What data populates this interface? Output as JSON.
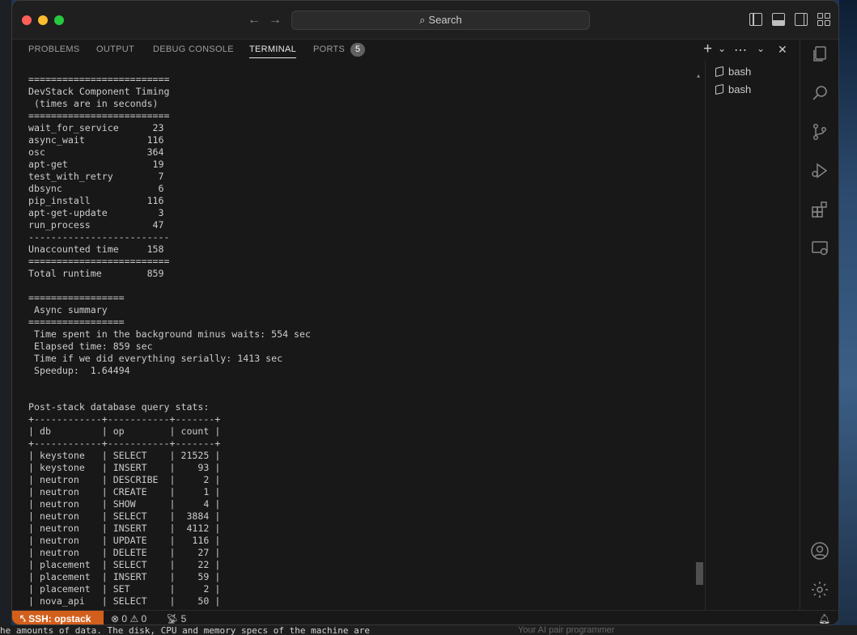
{
  "window": {
    "search_placeholder": "Search",
    "nav_back": "←",
    "nav_forward": "→"
  },
  "panel": {
    "tabs": [
      {
        "label": "PROBLEMS",
        "active": false
      },
      {
        "label": "OUTPUT",
        "active": false
      },
      {
        "label": "DEBUG CONSOLE",
        "active": false
      },
      {
        "label": "TERMINAL",
        "active": true
      },
      {
        "label": "PORTS",
        "active": false
      }
    ],
    "ports_badge": "5",
    "actions": {
      "new_terminal": "+",
      "dropdown": "⌄",
      "more": "⋯",
      "collapse": "⌄",
      "close": "✕"
    }
  },
  "terminal": {
    "lines": [
      "=========================",
      "DevStack Component Timing",
      " (times are in seconds)",
      "=========================",
      "wait_for_service      23",
      "async_wait           116",
      "osc                  364",
      "apt-get               19",
      "test_with_retry        7",
      "dbsync                 6",
      "pip_install          116",
      "apt-get-update         3",
      "run_process           47",
      "-------------------------",
      "Unaccounted time     158",
      "=========================",
      "Total runtime        859",
      "",
      "=================",
      " Async summary",
      "=================",
      " Time spent in the background minus waits: 554 sec",
      " Elapsed time: 859 sec",
      " Time if we did everything serially: 1413 sec",
      " Speedup:  1.64494",
      "",
      "",
      "Post-stack database query stats:",
      "+------------+-----------+-------+",
      "| db         | op        | count |",
      "+------------+-----------+-------+",
      "| keystone   | SELECT    | 21525 |",
      "| keystone   | INSERT    |    93 |",
      "| neutron    | DESCRIBE  |     2 |",
      "| neutron    | CREATE    |     1 |",
      "| neutron    | SHOW      |     4 |",
      "| neutron    | SELECT    |  3884 |",
      "| neutron    | INSERT    |  4112 |",
      "| neutron    | UPDATE    |   116 |",
      "| neutron    | DELETE    |    27 |",
      "| placement  | SELECT    |    22 |",
      "| placement  | INSERT    |    59 |",
      "| placement  | SET       |     2 |",
      "| nova_api   | SELECT    |    50 |"
    ]
  },
  "terminal_list": {
    "items": [
      {
        "label": "bash"
      },
      {
        "label": "bash"
      }
    ]
  },
  "statusbar": {
    "remote": "SSH: opstack",
    "errors": "0",
    "warnings": "0",
    "ports": "5"
  },
  "background": {
    "bottom_left_text": "he amounts of data. The disk, CPU and memory specs of the machine are",
    "bottom_right_text": "Your AI pair programmer"
  }
}
